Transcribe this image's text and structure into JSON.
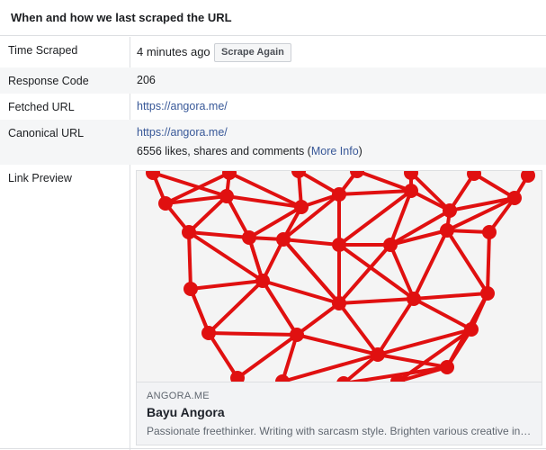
{
  "panel": {
    "title": "When and how we last scraped the URL"
  },
  "rows": {
    "time_scraped": {
      "label": "Time Scraped",
      "value": "4 minutes ago",
      "button": "Scrape Again"
    },
    "response_code": {
      "label": "Response Code",
      "value": "206"
    },
    "fetched_url": {
      "label": "Fetched URL",
      "value": "https://angora.me/"
    },
    "canonical_url": {
      "label": "Canonical URL",
      "value": "https://angora.me/",
      "engagement_text": "6556 likes, shares and comments (",
      "more_info": "More Info",
      "engagement_close": ")"
    },
    "link_preview": {
      "label": "Link Preview"
    }
  },
  "preview": {
    "domain": "ANGORA.ME",
    "title": "Bayu Angora",
    "description": "Passionate freethinker. Writing with sarcasm style. Brighten various creative industry and support any good campaign.",
    "network_color": "#e01010",
    "background_color": "#f4f4f4"
  }
}
